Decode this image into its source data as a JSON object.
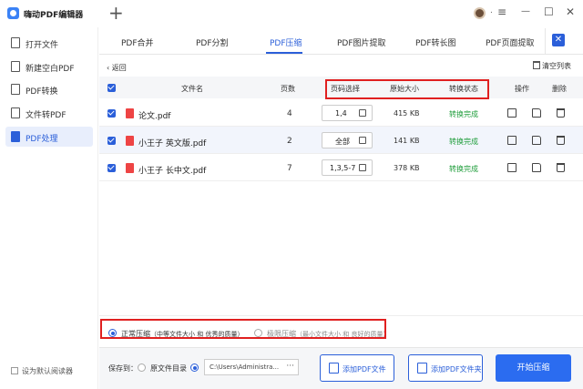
{
  "app": {
    "title": "嗨动PDF编辑器",
    "new_tab": "+"
  },
  "window": {
    "menu": "≡",
    "minimize": "—",
    "maximize": "☐",
    "close": "✕",
    "avatar_caret": "."
  },
  "sidebar": {
    "items": [
      {
        "label": "打开文件",
        "icon": "open-file-icon"
      },
      {
        "label": "新建空白PDF",
        "icon": "new-pdf-icon"
      },
      {
        "label": "PDF转换",
        "icon": "convert-icon"
      },
      {
        "label": "文件转PDF",
        "icon": "file-to-pdf-icon"
      },
      {
        "label": "PDF处理",
        "icon": "pdf-process-icon",
        "active": true
      }
    ],
    "default_reader": "设为默认阅读器"
  },
  "tabs": [
    "PDF合并",
    "PDF分割",
    "PDF压缩",
    "PDF图片提取",
    "PDF转长图",
    "PDF页面提取"
  ],
  "active_tab": "PDF压缩",
  "toolbar": {
    "back": "‹ 返回",
    "clear_list": "清空列表"
  },
  "table": {
    "headers": {
      "filename": "文件名",
      "pages": "页数",
      "page_range": "页码选择",
      "original_size": "原始大小",
      "status": "转换状态",
      "action": "操作",
      "delete": "删除"
    },
    "rows": [
      {
        "name": "论文.pdf",
        "pages": "4",
        "range": "1,4",
        "size": "415 KB",
        "status": "转换完成"
      },
      {
        "name": "小王子 英文版.pdf",
        "pages": "2",
        "range": "全部",
        "size": "141 KB",
        "status": "转换完成"
      },
      {
        "name": "小王子 长中文.pdf",
        "pages": "7",
        "range": "1,3,5-7",
        "size": "378 KB",
        "status": "转换完成"
      }
    ]
  },
  "compress": {
    "normal": {
      "name": "正常压缩",
      "desc": "（中等文件大小 和 优秀的质量）"
    },
    "extreme": {
      "name": "极限压缩",
      "desc": "（最小文件大小 和 良好的质量）"
    }
  },
  "footer": {
    "save_to": "保存到：",
    "source_dir": "原文件目录",
    "path": "C:\\Users\\Administra...",
    "more": "···",
    "add_file": "添加PDF文件",
    "add_folder": "添加PDF文件夹",
    "start": "开始压缩"
  },
  "colors": {
    "accent": "#2b5fd9",
    "success": "#1f9d3b",
    "highlight_box": "#e02020",
    "pdf_icon": "#e44444"
  }
}
